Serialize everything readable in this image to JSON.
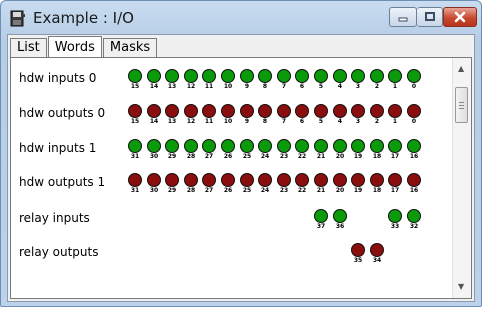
{
  "window": {
    "title": "Example : I/O",
    "icon": "disk-app-icon",
    "controls": {
      "minimize": "minimize-icon",
      "maximize": "maximize-icon",
      "close": "close-icon"
    }
  },
  "tabs": [
    {
      "label": "List",
      "active": false
    },
    {
      "label": "Words",
      "active": true
    },
    {
      "label": "Masks",
      "active": false
    }
  ],
  "colors": {
    "led_on": "#0a9a0a",
    "led_off": "#8b0e0e"
  },
  "rows": [
    {
      "label": "hdw inputs 0",
      "color": "green",
      "leds": [
        {
          "c": 0,
          "n": "15"
        },
        {
          "c": 1,
          "n": "14"
        },
        {
          "c": 2,
          "n": "13"
        },
        {
          "c": 3,
          "n": "12"
        },
        {
          "c": 4,
          "n": "11"
        },
        {
          "c": 5,
          "n": "10"
        },
        {
          "c": 6,
          "n": "9"
        },
        {
          "c": 7,
          "n": "8"
        },
        {
          "c": 8,
          "n": "7"
        },
        {
          "c": 9,
          "n": "6"
        },
        {
          "c": 10,
          "n": "5"
        },
        {
          "c": 11,
          "n": "4"
        },
        {
          "c": 12,
          "n": "3"
        },
        {
          "c": 13,
          "n": "2"
        },
        {
          "c": 14,
          "n": "1"
        },
        {
          "c": 15,
          "n": "0"
        }
      ]
    },
    {
      "label": "hdw outputs 0",
      "color": "red",
      "leds": [
        {
          "c": 0,
          "n": "15"
        },
        {
          "c": 1,
          "n": "14"
        },
        {
          "c": 2,
          "n": "13"
        },
        {
          "c": 3,
          "n": "12"
        },
        {
          "c": 4,
          "n": "11"
        },
        {
          "c": 5,
          "n": "10"
        },
        {
          "c": 6,
          "n": "9"
        },
        {
          "c": 7,
          "n": "8"
        },
        {
          "c": 8,
          "n": "7"
        },
        {
          "c": 9,
          "n": "6"
        },
        {
          "c": 10,
          "n": "5"
        },
        {
          "c": 11,
          "n": "4"
        },
        {
          "c": 12,
          "n": "3"
        },
        {
          "c": 13,
          "n": "2"
        },
        {
          "c": 14,
          "n": "1"
        },
        {
          "c": 15,
          "n": "0"
        }
      ]
    },
    {
      "label": "hdw inputs 1",
      "color": "green",
      "leds": [
        {
          "c": 0,
          "n": "31"
        },
        {
          "c": 1,
          "n": "30"
        },
        {
          "c": 2,
          "n": "29"
        },
        {
          "c": 3,
          "n": "28"
        },
        {
          "c": 4,
          "n": "27"
        },
        {
          "c": 5,
          "n": "26"
        },
        {
          "c": 6,
          "n": "25"
        },
        {
          "c": 7,
          "n": "24"
        },
        {
          "c": 8,
          "n": "23"
        },
        {
          "c": 9,
          "n": "22"
        },
        {
          "c": 10,
          "n": "21"
        },
        {
          "c": 11,
          "n": "20"
        },
        {
          "c": 12,
          "n": "19"
        },
        {
          "c": 13,
          "n": "18"
        },
        {
          "c": 14,
          "n": "17"
        },
        {
          "c": 15,
          "n": "16"
        }
      ]
    },
    {
      "label": "hdw outputs 1",
      "color": "red",
      "leds": [
        {
          "c": 0,
          "n": "31"
        },
        {
          "c": 1,
          "n": "30"
        },
        {
          "c": 2,
          "n": "29"
        },
        {
          "c": 3,
          "n": "28"
        },
        {
          "c": 4,
          "n": "27"
        },
        {
          "c": 5,
          "n": "26"
        },
        {
          "c": 6,
          "n": "25"
        },
        {
          "c": 7,
          "n": "24"
        },
        {
          "c": 8,
          "n": "23"
        },
        {
          "c": 9,
          "n": "22"
        },
        {
          "c": 10,
          "n": "21"
        },
        {
          "c": 11,
          "n": "20"
        },
        {
          "c": 12,
          "n": "19"
        },
        {
          "c": 13,
          "n": "18"
        },
        {
          "c": 14,
          "n": "17"
        },
        {
          "c": 15,
          "n": "16"
        }
      ]
    },
    {
      "label": "relay inputs",
      "color": "green",
      "leds": [
        {
          "c": 10,
          "n": "37"
        },
        {
          "c": 11,
          "n": "36"
        },
        {
          "c": 14,
          "n": "33"
        },
        {
          "c": 15,
          "n": "32"
        }
      ]
    },
    {
      "label": "relay outputs",
      "color": "red",
      "leds": [
        {
          "c": 12,
          "n": "35"
        },
        {
          "c": 13,
          "n": "34"
        }
      ]
    }
  ],
  "scrollbar": {
    "up": "scroll-up-arrow-icon",
    "down": "scroll-down-arrow-icon"
  }
}
